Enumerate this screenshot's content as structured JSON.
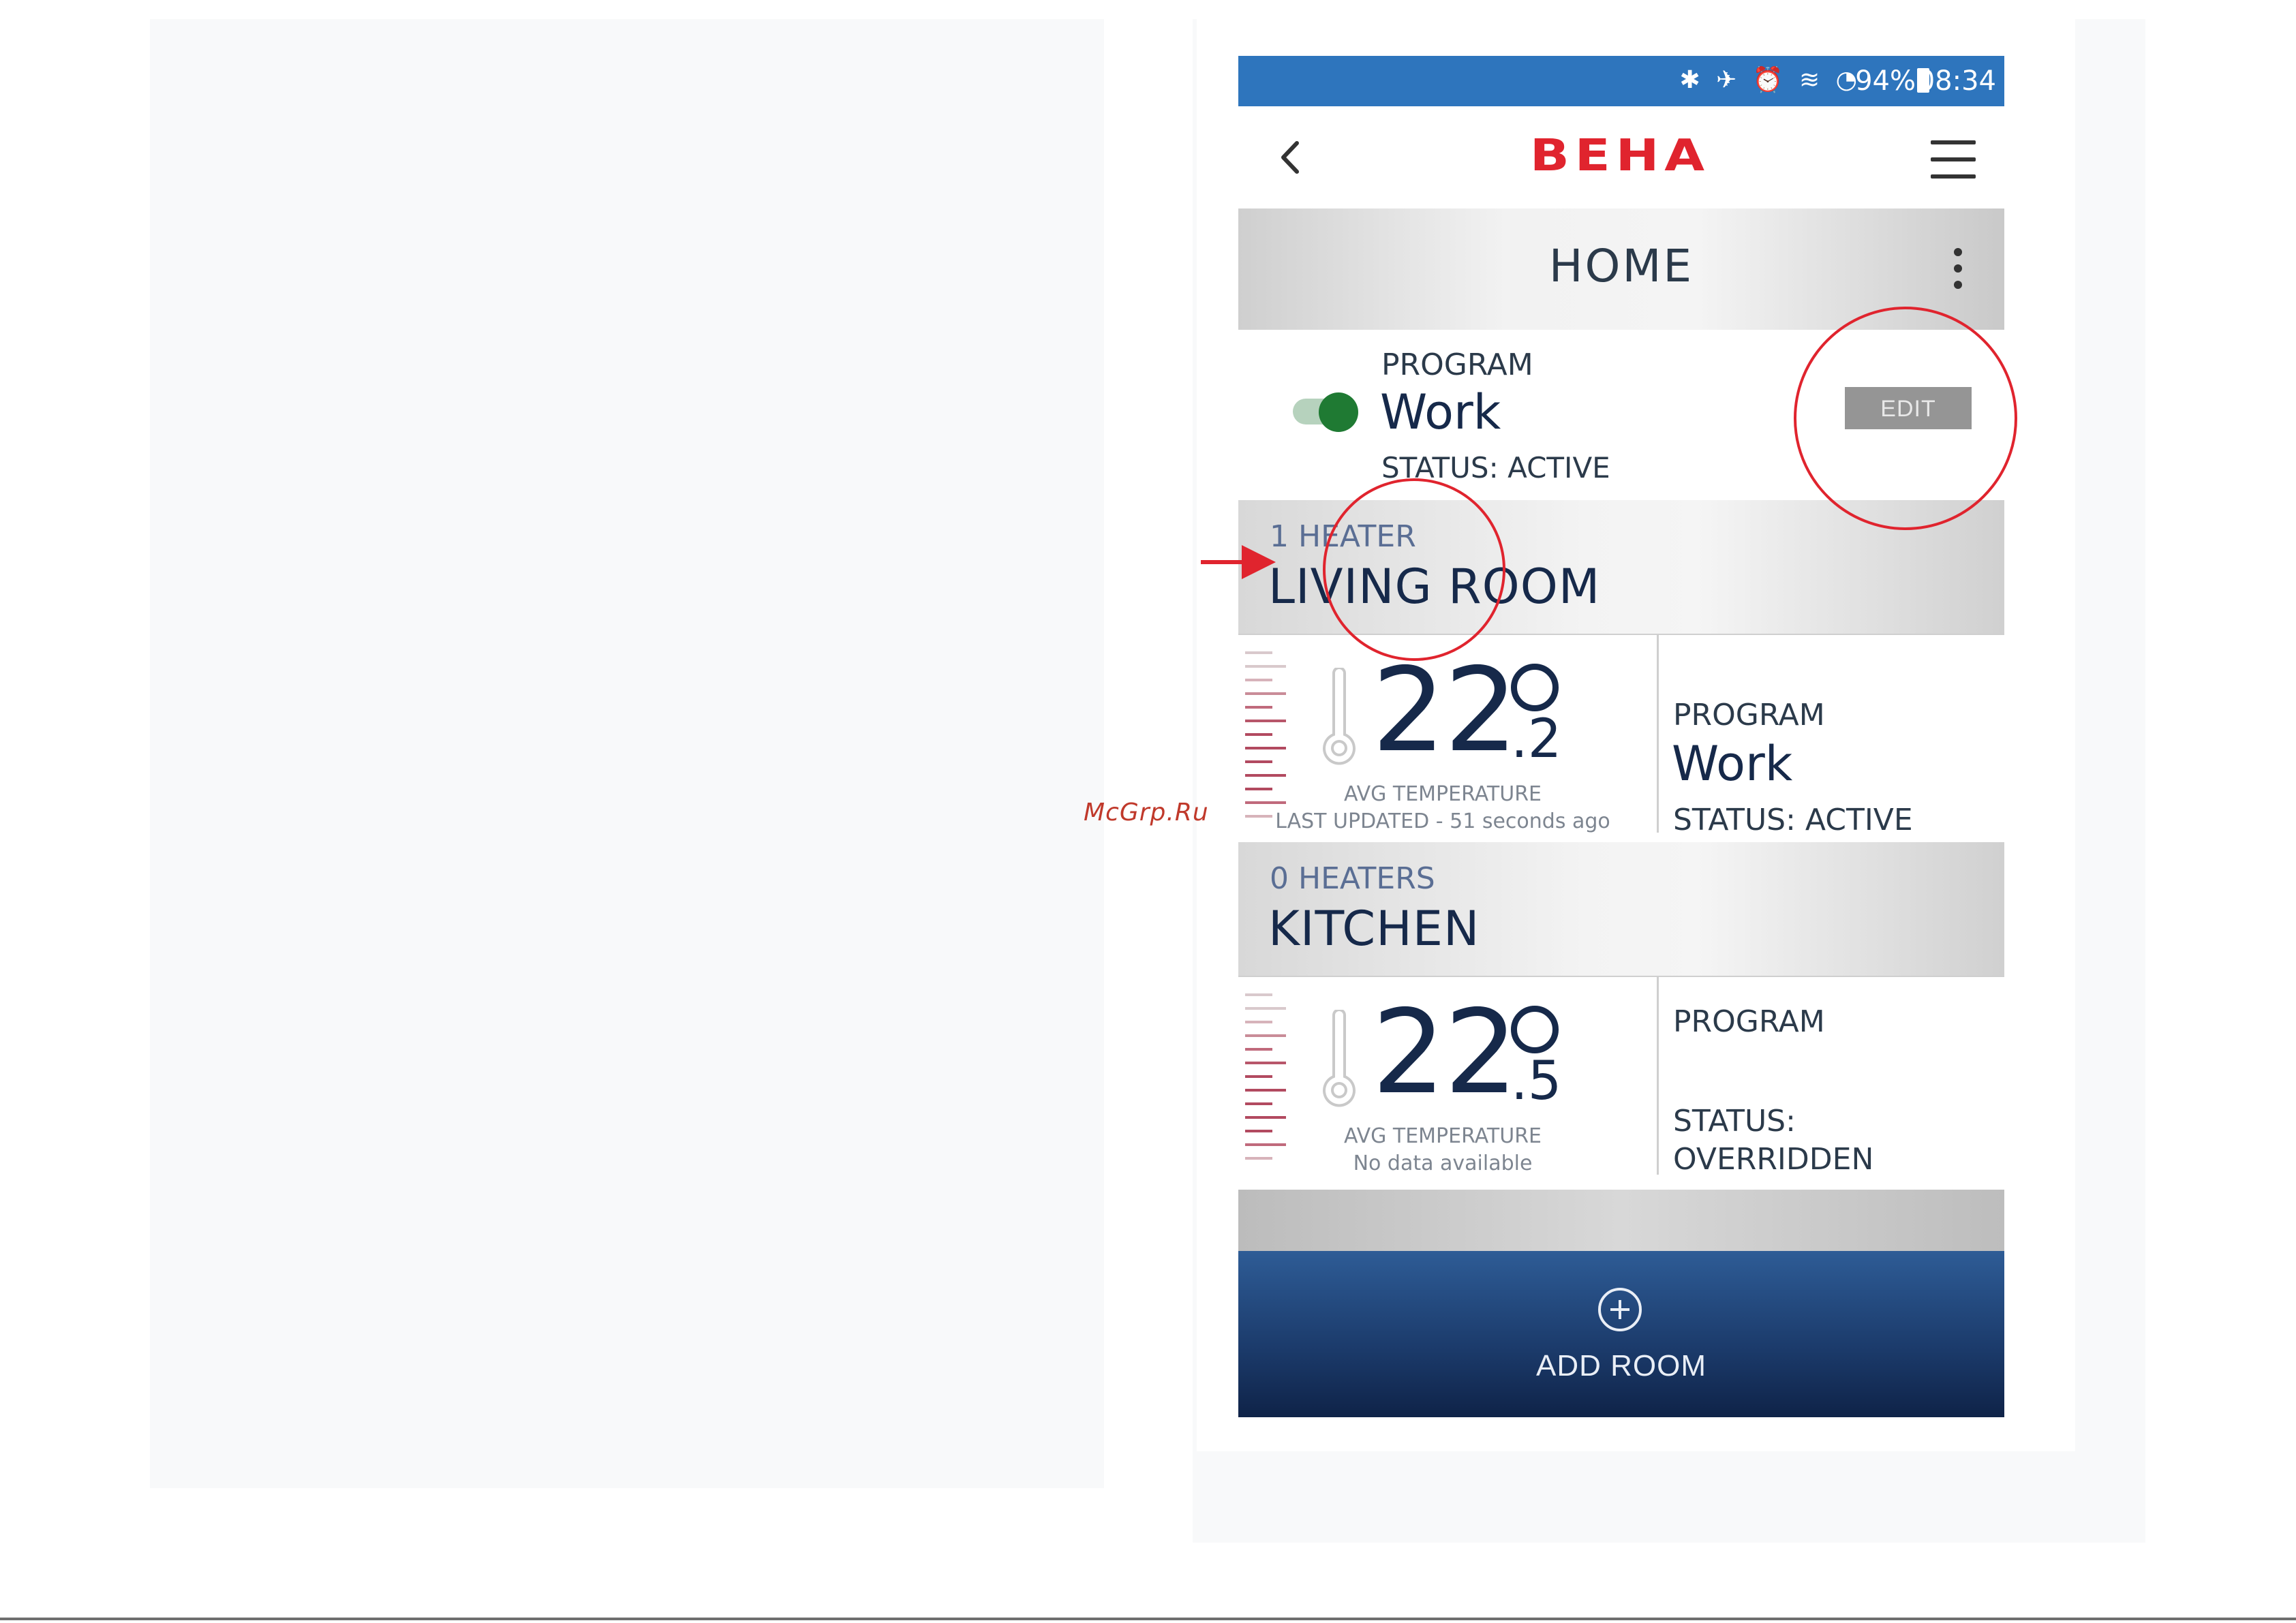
{
  "watermark": "McGrp.Ru",
  "status_bar": {
    "icons": "✱ ✈ ⏰ ≋ ◔",
    "battery": "94%",
    "time": "08:34"
  },
  "app_bar": {
    "logo": "BEHA",
    "back_icon": "chevron-left-icon",
    "menu_icon": "hamburger-icon"
  },
  "home": {
    "title": "HOME"
  },
  "program": {
    "label": "PROGRAM",
    "name": "Work",
    "status": "STATUS: ACTIVE",
    "edit_label": "EDIT",
    "toggle_on": true
  },
  "rooms": [
    {
      "count": "1 HEATER",
      "name": "LIVING ROOM",
      "temp_int": "22",
      "temp_dec": ".2",
      "avg_label": "AVG TEMPERATURE",
      "updated": "LAST UPDATED - 51 seconds ago",
      "program_label": "PROGRAM",
      "program_name": "Work",
      "program_status": "STATUS: ACTIVE"
    },
    {
      "count": "0 HEATERS",
      "name": "KITCHEN",
      "temp_int": "22",
      "temp_dec": ".5",
      "avg_label": "AVG TEMPERATURE",
      "updated": "No data available",
      "program_label": "PROGRAM",
      "program_status": "STATUS: OVERRIDDEN"
    }
  ],
  "add_room": {
    "label": "ADD ROOM",
    "icon": "plus-circle-icon"
  },
  "colors": {
    "status_bar": "#2e75bd",
    "brand_red": "#e0242e",
    "toggle_on": "#1f7a33",
    "text_dark": "#16294a",
    "annotation_red": "#e0242e"
  }
}
